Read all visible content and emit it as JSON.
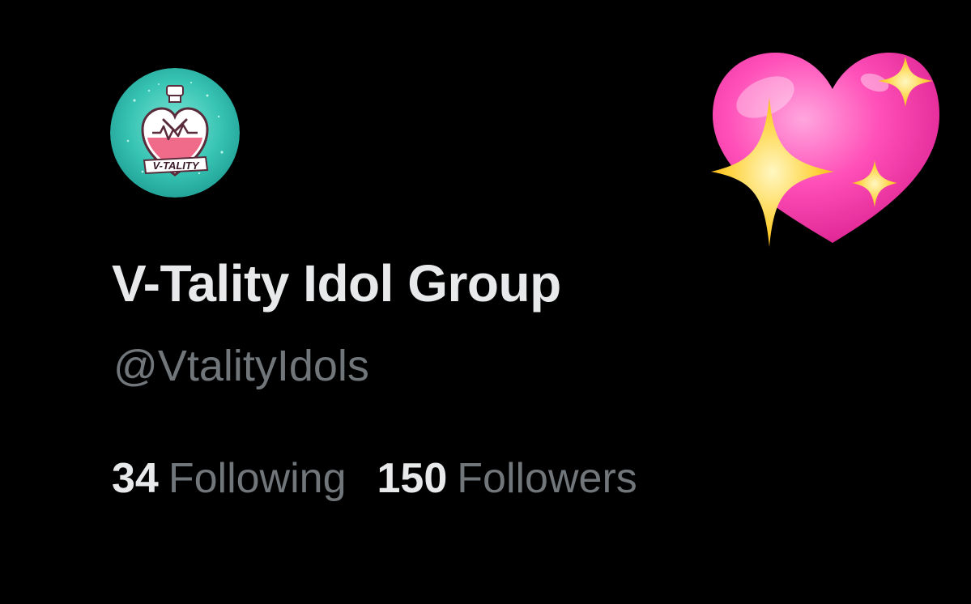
{
  "profile": {
    "display_name": "V-Tality Idol Group",
    "handle": "@VtalityIdols",
    "avatar_icon": "v-tality-potion-logo",
    "avatar_logo_text": "V-TALITY",
    "decoration_icon": "sparkling-heart-emoji"
  },
  "stats": {
    "following_count": "34",
    "following_label": "Following",
    "followers_count": "150",
    "followers_label": "Followers"
  },
  "colors": {
    "background": "#000000",
    "primary_text": "#e7e9ea",
    "secondary_text": "#71767b",
    "avatar_teal": "#3cc9b8",
    "heart_pink": "#ff4fb8",
    "sparkle_yellow": "#ffd23c"
  }
}
